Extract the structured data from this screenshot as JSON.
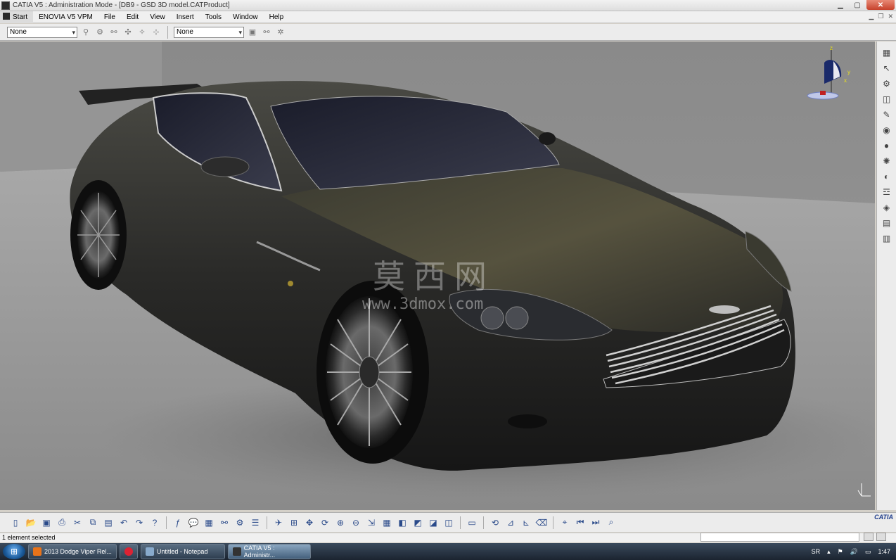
{
  "window": {
    "title": "CATIA V5 : Administration Mode - [DB9 - GSD 3D model.CATProduct]"
  },
  "menu": {
    "items": [
      "Start",
      "ENOVIA V5 VPM",
      "File",
      "Edit",
      "View",
      "Insert",
      "Tools",
      "Window",
      "Help"
    ]
  },
  "toolbar1": {
    "select1_value": "None",
    "select2_value": "None"
  },
  "viewport": {
    "watermark_cn": "莫西网",
    "watermark_url": "www.3dmox.com",
    "compass_axes": [
      "z",
      "y",
      "x"
    ]
  },
  "status": {
    "message": "1 element selected"
  },
  "taskbar": {
    "items": [
      {
        "label": "2013 Dodge Viper Rel...",
        "icon_color": "#e8731a"
      },
      {
        "label": "",
        "icon_color": "#d23"
      },
      {
        "label": "Untitled - Notepad",
        "icon_color": "#8ac"
      },
      {
        "label": "CATIA V5 : Administr...",
        "icon_color": "#333"
      }
    ],
    "lang": "SR",
    "time": "1:47"
  },
  "logo": {
    "text": "CATIA"
  }
}
